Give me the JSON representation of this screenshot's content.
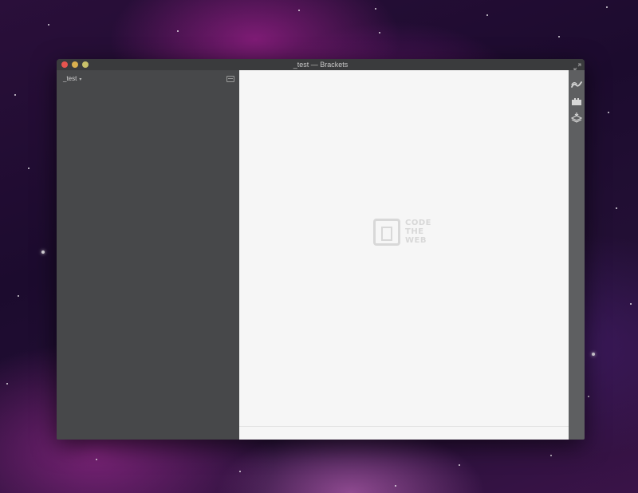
{
  "window": {
    "title": "_test — Brackets"
  },
  "sidebar": {
    "project_name": "_test",
    "project_caret": "▾"
  },
  "editor": {
    "watermark": [
      "CODE",
      "THE",
      "WEB"
    ]
  },
  "toolbar": {
    "icons": [
      "live-preview-icon",
      "extension-manager-icon",
      "extension-icon"
    ]
  },
  "colors": {
    "sidebar_bg": "#47484a",
    "editor_bg": "#f6f6f6",
    "toolbar_bg": "#5e5f61",
    "close": "#e6544f",
    "minimize": "#d9b04e",
    "maximize": "#c9c16a"
  }
}
